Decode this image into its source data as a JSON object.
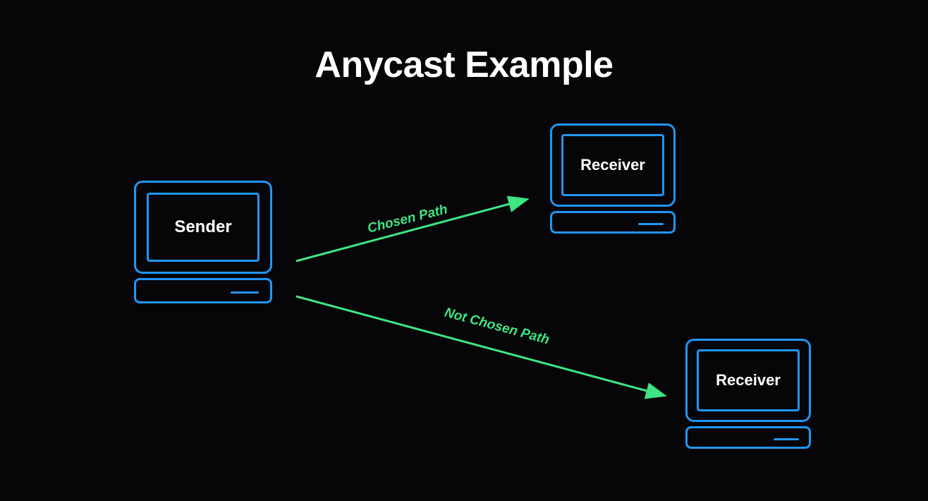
{
  "title": "Anycast Example",
  "nodes": {
    "sender": {
      "label": "Sender"
    },
    "receiver1": {
      "label": "Receiver"
    },
    "receiver2": {
      "label": "Receiver"
    }
  },
  "paths": {
    "chosen": {
      "label": "Chosen Path"
    },
    "not_chosen": {
      "label": "Not Chosen Path"
    }
  },
  "colors": {
    "background": "#060608",
    "computer_stroke": "#2196f3",
    "arrow": "#3ee583",
    "text": "#ffffff"
  }
}
